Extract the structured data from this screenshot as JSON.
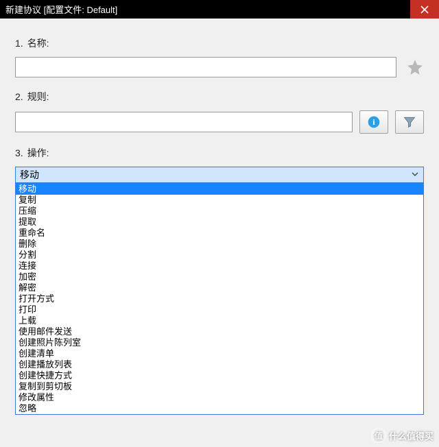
{
  "window": {
    "title": "新建协议 [配置文件: Default]"
  },
  "form": {
    "name": {
      "num": "1.",
      "label": "名称:",
      "value": ""
    },
    "rule": {
      "num": "2.",
      "label": "规则:",
      "value": ""
    },
    "action": {
      "num": "3.",
      "label": "操作:",
      "selected": "移动"
    },
    "action_options": [
      "移动",
      "复制",
      "压缩",
      "提取",
      "重命名",
      "删除",
      "分割",
      "连接",
      "加密",
      "解密",
      "打开方式",
      "打印",
      "上载",
      "使用邮件发送",
      "创建照片陈列室",
      "创建清单",
      "创建播放列表",
      "创建快捷方式",
      "复制到剪切板",
      "修改属性",
      "忽略"
    ]
  },
  "icons": {
    "close": "close-icon",
    "favorite": "star-icon",
    "info": "info-icon",
    "filter": "funnel-icon",
    "chevron": "chevron-down-icon"
  },
  "watermark": {
    "badge": "值",
    "text": "什么值得买"
  }
}
